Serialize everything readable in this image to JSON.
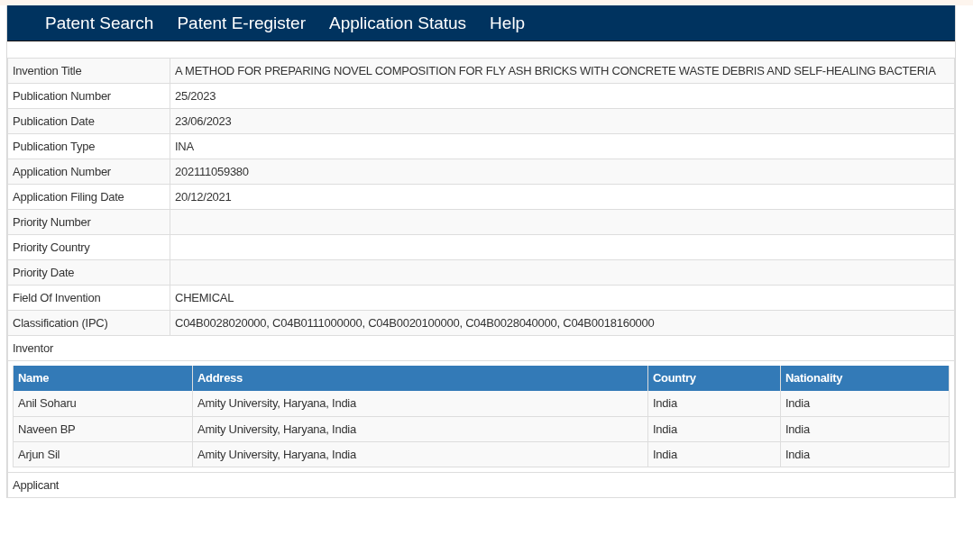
{
  "nav": [
    {
      "label": "Patent Search"
    },
    {
      "label": "Patent E-register"
    },
    {
      "label": "Application Status"
    },
    {
      "label": "Help"
    }
  ],
  "details": [
    {
      "label": "Invention Title",
      "value": "A METHOD FOR PREPARING NOVEL COMPOSITION FOR FLY ASH BRICKS WITH CONCRETE WASTE DEBRIS AND SELF-HEALING BACTERIA"
    },
    {
      "label": "Publication Number",
      "value": "25/2023"
    },
    {
      "label": "Publication Date",
      "value": "23/06/2023"
    },
    {
      "label": "Publication Type",
      "value": "INA"
    },
    {
      "label": "Application Number",
      "value": "202111059380"
    },
    {
      "label": "Application Filing Date",
      "value": "20/12/2021"
    },
    {
      "label": "Priority Number"
    },
    {
      "label": "Priority Country"
    },
    {
      "label": "Priority Date"
    },
    {
      "label": "Field Of Invention",
      "value": "CHEMICAL"
    },
    {
      "label": "Classification (IPC)",
      "value": "C04B0028020000, C04B0111000000, C04B0020100000, C04B0028040000, C04B0018160000"
    }
  ],
  "inventor": {
    "title": "Inventor",
    "table": {
      "columns": [
        "Name",
        "Address",
        "Country",
        "Nationality"
      ],
      "rows": [
        [
          "Anil Soharu",
          "Amity University, Haryana, India",
          "India",
          "India"
        ],
        [
          "Naveen BP",
          "Amity University, Haryana, India",
          "India",
          "India"
        ],
        [
          "Arjun Sil",
          "Amity University, Haryana, India",
          "India",
          "India"
        ]
      ]
    }
  },
  "applicant": {
    "title": "Applicant"
  }
}
